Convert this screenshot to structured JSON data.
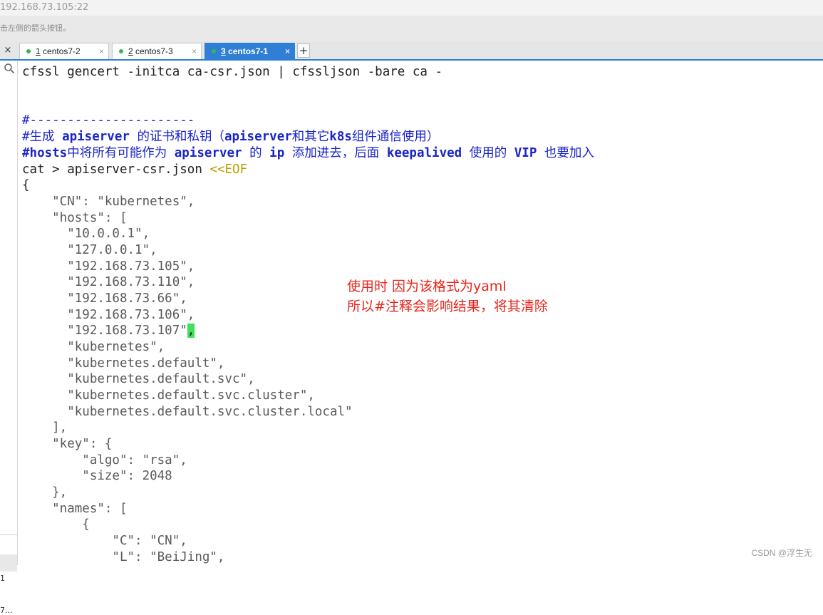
{
  "window": {
    "title": "192.168.73.105:22",
    "hint": "击左侧的箭头按钮。"
  },
  "tabs": [
    {
      "num": "1",
      "label": " centos7-2",
      "active": false
    },
    {
      "num": "2",
      "label": " centos7-3",
      "active": false
    },
    {
      "num": "3",
      "label": " centos7-1",
      "active": true
    }
  ],
  "toolbar": {
    "close_label": "×",
    "add_tab_label": "+",
    "tab_close": "×"
  },
  "sidebar": {
    "item1": "1",
    "item2": "7..."
  },
  "terminal": {
    "line01": "cfssl gencert -initca ca-csr.json | cfssljson -bare ca -",
    "line02": "#----------------------",
    "line03a": "#生成 ",
    "line03b": "apiserver",
    "line03c": " 的证书和私钥（",
    "line03d": "apiserver",
    "line03e": "和其它",
    "line03f": "k8s",
    "line03g": "组件通信使用）",
    "line04a": "#hosts",
    "line04b": "中将所有可能作为 ",
    "line04c": "apiserver",
    "line04d": " 的 ",
    "line04e": "ip",
    "line04f": " 添加进去，后面 ",
    "line04g": "keepalived",
    "line04h": " 使用的 ",
    "line04i": "VIP",
    "line04j": " 也要加入",
    "line05a": "cat > apiserver-csr.json ",
    "line05b": "<<EOF",
    "line06": "{",
    "line07": "    \"CN\": \"kubernetes\",",
    "line08": "    \"hosts\": [",
    "line09": "      \"10.0.0.1\",",
    "line10": "      \"127.0.0.1\",",
    "line11": "      \"192.168.73.105\",",
    "line12": "      \"192.168.73.110\",",
    "line13": "      \"192.168.73.66\",",
    "line14": "      \"192.168.73.106\",",
    "line15a": "      \"192.168.73.107\"",
    "line15b": ",",
    "line16": "      \"kubernetes\",",
    "line17": "      \"kubernetes.default\",",
    "line18": "      \"kubernetes.default.svc\",",
    "line19": "      \"kubernetes.default.svc.cluster\",",
    "line20": "      \"kubernetes.default.svc.cluster.local\"",
    "line21": "    ],",
    "line22": "    \"key\": {",
    "line23": "        \"algo\": \"rsa\",",
    "line24": "        \"size\": 2048",
    "line25": "    },",
    "line26": "    \"names\": [",
    "line27": "        {",
    "line28": "            \"C\": \"CN\",",
    "line29": "            \"L\": \"BeiJing\","
  },
  "annotation": {
    "line1": "使用时 因为该格式为yaml",
    "line2": "所以#注释会影响结果，将其清除"
  },
  "watermark": "CSDN @浮生无"
}
